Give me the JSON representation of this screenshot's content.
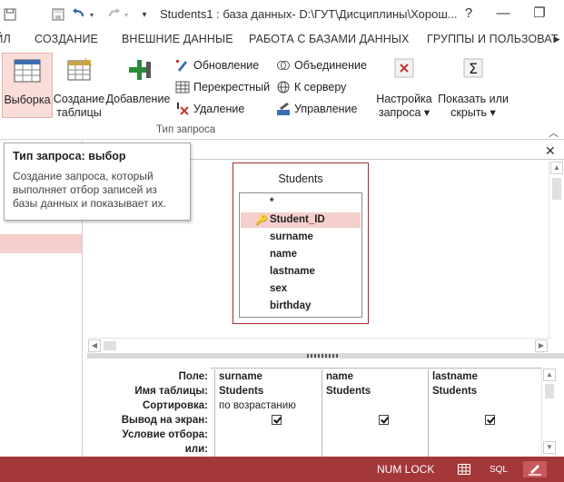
{
  "titlebar": {
    "title": "Students1 : база данных- D:\\ГУТ\\Дисциплины\\Хорош...",
    "help": "?",
    "minimize": "—",
    "restore": "❐",
    "undo_icon": "undo-icon",
    "redo_icon": "redo-icon"
  },
  "tabs": {
    "items": [
      "АЙЛ",
      "СОЗДАНИЕ",
      "ВНЕШНИЕ ДАННЫЕ",
      "РАБОТА С БАЗАМИ ДАННЫХ",
      "ГРУППЫ И ПОЛЬЗОВАТ"
    ],
    "first_visible": "АЙЛ",
    "more_arrow": "►"
  },
  "ribbon": {
    "select_button": "Выборка",
    "make_table_button_line1": "Создание",
    "make_table_button_line2": "таблицы",
    "append_button": "Добавление",
    "update_button": "Обновление",
    "crosstab_button": "Перекрестный",
    "delete_button": "Удаление",
    "union_button": "Объединение",
    "passthrough_button": "К серверу",
    "ddl_button": "Управление",
    "setup_button_line1": "Настройка",
    "setup_button_line2": "запроса",
    "showhide_button_line1": "Показать или",
    "showhide_button_line2": "скрыть",
    "group_label": "Тип запроса",
    "accent_color": "#a4373a"
  },
  "tooltip": {
    "title": "Тип запроса: выбор",
    "text": "Создание запроса, который выполняет отбор записей из базы данных и показывает их."
  },
  "design": {
    "table_name": "Students",
    "fields": [
      "*",
      "Student_ID",
      "surname",
      "name",
      "lastname",
      "sex",
      "birthday"
    ],
    "primary_key": "Student_ID"
  },
  "grid": {
    "row_labels": [
      "Поле:",
      "Имя таблицы:",
      "Сортировка:",
      "Вывод на экран:",
      "Условие отбора:",
      "или:"
    ],
    "columns": [
      {
        "field": "surname",
        "table": "Students",
        "sort": "по возрастанию",
        "show": true
      },
      {
        "field": "name",
        "table": "Students",
        "sort": "",
        "show": true
      },
      {
        "field": "lastname",
        "table": "Students",
        "sort": "",
        "show": true
      }
    ]
  },
  "statusbar": {
    "numlock": "NUM LOCK",
    "sql": "SQL",
    "color": "#a4373a"
  }
}
